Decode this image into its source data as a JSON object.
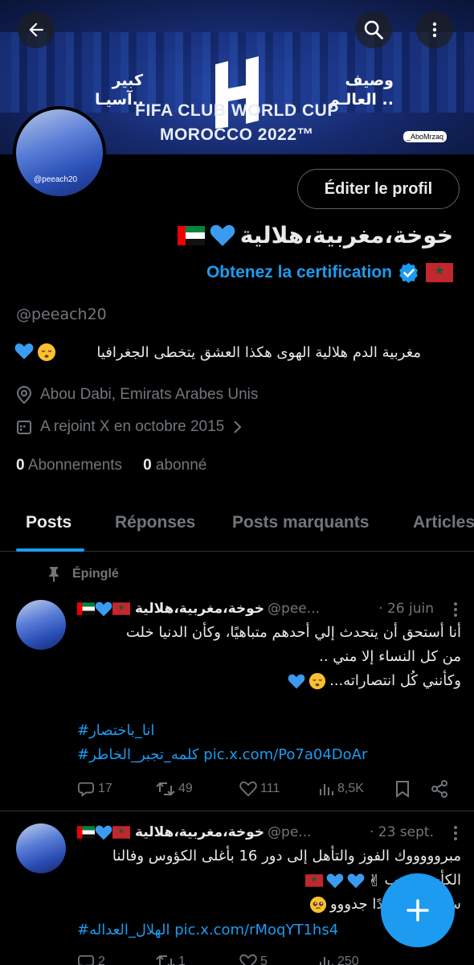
{
  "banner": {
    "line1": "FIFA CLUB WORLD CUP",
    "line2": "MOROCCO 2022™",
    "left_text": "كبير آسيـا..",
    "right_text": "وصيف العالـم ..",
    "watermark": "_AboMrzaq"
  },
  "profile": {
    "avatar_text": "@peeach20",
    "edit_button": "Éditer le profil",
    "display_name": "خوخة،مغربية،هلالية",
    "certification": "Obtenez la certification",
    "handle": "@peeach20",
    "bio": "مغربية الدم هلالية الهوى هكذا العشق يتخطى الجغرافيا",
    "location": "Abou Dabi, Emirats Arabes Unis",
    "joined": "A rejoint X en octobre 2015",
    "following_count": "0",
    "following_label": "Abonnements",
    "followers_count": "0",
    "followers_label": "abonné"
  },
  "tabs": [
    "Posts",
    "Réponses",
    "Posts marquants",
    "Articles"
  ],
  "pinned_label": "Épinglé",
  "posts": [
    {
      "name": "خوخة،مغربية،هلالية",
      "handle": "@pee...",
      "date": "· 26 juin",
      "lines": [
        "أنا أستحق أن يتحدث إلي أحدهم متباهيًا، وكأن الدنيا خلت",
        "من كل النساء إلا مني ..",
        "وكأنني كُل انتصاراته..."
      ],
      "hashtag1": "#انا_باختصار",
      "hashtag2": "#كلمه_تجبر_الخاطر",
      "link": "pic.x.com/Po7a04DoAr",
      "replies": "17",
      "reposts": "49",
      "likes": "111",
      "views": "8,5K"
    },
    {
      "name": "خوخة،مغربية،هلالية",
      "handle": "@pe...",
      "date": "· 23 sept.",
      "lines": [
        "مبروووووك الفوز والتأهل إلى دور 16 بأغلى الكؤوس وفالنا",
        "الكأس يا رب",
        "سعيدة جدًا جدًا جدووو"
      ],
      "hashtag1": "#الهلال_العداله",
      "link": "pic.x.com/rMoqYT1hs4",
      "replies": "2",
      "reposts": "1",
      "likes": "5",
      "views": "250"
    }
  ],
  "colors": {
    "accent": "#1d9bf0",
    "muted": "#71767b",
    "background": "#000000",
    "divider": "#2f3336"
  }
}
